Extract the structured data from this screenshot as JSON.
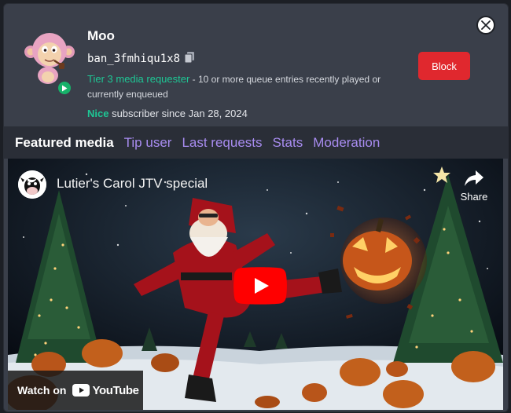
{
  "user": {
    "name": "Moo",
    "id": "ban_3fmhiqu1x8",
    "tier": "Tier 3 media requester",
    "tier_desc": " - 10 or more queue entries recently played or currently enqueued",
    "sub_badge": "Nice",
    "sub_text": " subscriber since Jan 28, 2024"
  },
  "actions": {
    "block_label": "Block"
  },
  "tabs": [
    {
      "label": "Featured media",
      "active": true
    },
    {
      "label": "Tip user"
    },
    {
      "label": "Last requests"
    },
    {
      "label": "Stats"
    },
    {
      "label": "Moderation"
    }
  ],
  "video": {
    "title": "Lutier's Carol JTV special",
    "share_label": "Share",
    "watch_on": "Watch on",
    "platform": "YouTube"
  },
  "colors": {
    "accent_green": "#1ec795",
    "block_red": "#e0282e",
    "tab_purple": "#a88cf0",
    "youtube_red": "#ff0000"
  },
  "icons": [
    "close-icon",
    "copy-icon",
    "play-badge-icon",
    "share-icon",
    "youtube-play-icon",
    "youtube-logo-icon",
    "monkey-avatar",
    "cow-channel-icon"
  ]
}
